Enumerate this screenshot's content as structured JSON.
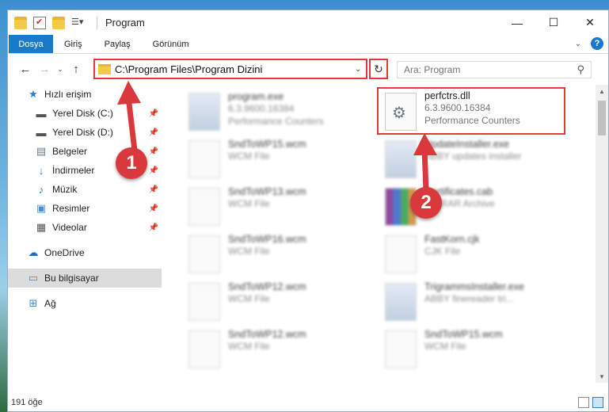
{
  "window": {
    "title": "Program",
    "controls": {
      "minimize": "—",
      "maximize": "☐",
      "close": "✕"
    }
  },
  "ribbon": {
    "tabs": [
      "Dosya",
      "Giriş",
      "Paylaş",
      "Görünüm"
    ],
    "help": "?"
  },
  "nav": {
    "back": "←",
    "forward": "→",
    "recent": "⌄",
    "up": "↑",
    "address": "C:\\Program Files\\Program Dizini",
    "refresh": "↻",
    "search_placeholder": "Ara: Program"
  },
  "sidebar": {
    "quick_access": "Hızlı erişim",
    "items": [
      {
        "label": "Yerel Disk (C:)",
        "icon": "drive-icon"
      },
      {
        "label": "Yerel Disk (D:)",
        "icon": "drive-icon"
      },
      {
        "label": "Belgeler",
        "icon": "documents-icon"
      },
      {
        "label": "İndirmeler",
        "icon": "downloads-icon"
      },
      {
        "label": "Müzik",
        "icon": "music-icon"
      },
      {
        "label": "Resimler",
        "icon": "pictures-icon"
      },
      {
        "label": "Videolar",
        "icon": "videos-icon"
      }
    ],
    "onedrive": "OneDrive",
    "this_pc": "Bu bilgisayar",
    "network": "Ağ"
  },
  "files": {
    "left": [
      {
        "name": "program.exe",
        "line2": "6.3.9600.16384",
        "line3": "Performance Counters"
      },
      {
        "name": "SndToWP15.wcm",
        "line2": "WCM File",
        "line3": ""
      },
      {
        "name": "SndToWP13.wcm",
        "line2": "WCM File",
        "line3": ""
      },
      {
        "name": "SndToWP16.wcm",
        "line2": "WCM File",
        "line3": ""
      },
      {
        "name": "SndToWP12.wcm",
        "line2": "WCM File",
        "line3": ""
      },
      {
        "name": "SndToWP12.wcm",
        "line2": "WCM File",
        "line3": ""
      }
    ],
    "right": [
      {
        "name": "perfctrs.dll",
        "line2": "6.3.9600.16384",
        "line3": "Performance Counters"
      },
      {
        "name": "UpdateInstaller.exe",
        "line2": "ABBY updates installer",
        "line3": ""
      },
      {
        "name": "Certificates.cab",
        "line2": "WinRAR Archive",
        "line3": ""
      },
      {
        "name": "FastKorn.cjk",
        "line2": "CJK File",
        "line3": ""
      },
      {
        "name": "TrigrammsInstaller.exe",
        "line2": "ABBY finereader tri...",
        "line3": ""
      },
      {
        "name": "SndToWP15.wcm",
        "line2": "WCM File",
        "line3": ""
      }
    ]
  },
  "annotations": {
    "step1": "1",
    "step2": "2"
  },
  "status": {
    "count": "191 öğe"
  },
  "colors": {
    "accent": "#1979ca",
    "annotation": "#d9383c"
  }
}
